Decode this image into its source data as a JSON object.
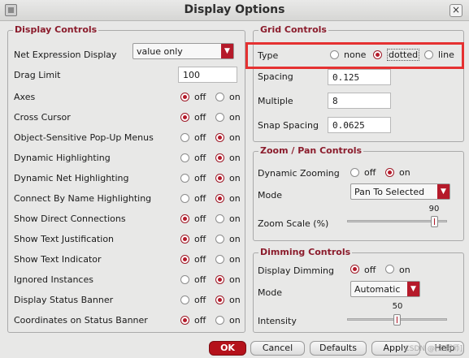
{
  "window": {
    "title": "Display Options"
  },
  "display_controls": {
    "title": "Display Controls",
    "net_expression": {
      "label": "Net Expression Display",
      "value": "value only"
    },
    "drag_limit": {
      "label": "Drag Limit",
      "value": "100"
    },
    "rows": [
      {
        "label": "Axes",
        "selected": "off"
      },
      {
        "label": "Cross Cursor",
        "selected": "off"
      },
      {
        "label": "Object-Sensitive Pop-Up Menus",
        "selected": "on"
      },
      {
        "label": "Dynamic Highlighting",
        "selected": "on"
      },
      {
        "label": "Dynamic Net Highlighting",
        "selected": "on"
      },
      {
        "label": "Connect By Name Highlighting",
        "selected": "on"
      },
      {
        "label": "Show Direct Connections",
        "selected": "off"
      },
      {
        "label": "Show Text Justification",
        "selected": "off"
      },
      {
        "label": "Show Text Indicator",
        "selected": "off"
      },
      {
        "label": "Ignored Instances",
        "selected": "on"
      },
      {
        "label": "Display Status Banner",
        "selected": "on"
      },
      {
        "label": "Coordinates on Status Banner",
        "selected": "off"
      }
    ],
    "opt_off": "off",
    "opt_on": "on"
  },
  "grid_controls": {
    "title": "Grid Controls",
    "type_label": "Type",
    "type_options": [
      "none",
      "dotted",
      "line"
    ],
    "type_selected": "dotted",
    "spacing": {
      "label": "Spacing",
      "value": "0.125"
    },
    "multiple": {
      "label": "Multiple",
      "value": "8"
    },
    "snap_spacing": {
      "label": "Snap Spacing",
      "value": "0.0625"
    }
  },
  "zoom_pan": {
    "title": "Zoom / Pan Controls",
    "dynamic_zooming": {
      "label": "Dynamic Zooming",
      "selected": "on"
    },
    "mode": {
      "label": "Mode",
      "value": "Pan To Selected"
    },
    "zoom_scale": {
      "label": "Zoom Scale (%)",
      "value": "90",
      "fraction": 0.9
    },
    "opt_off": "off",
    "opt_on": "on"
  },
  "dimming": {
    "title": "Dimming Controls",
    "display_dimming": {
      "label": "Display Dimming",
      "selected": "off"
    },
    "mode": {
      "label": "Mode",
      "value": "Automatic"
    },
    "intensity": {
      "label": "Intensity",
      "value": "50",
      "fraction": 0.5
    },
    "opt_off": "off",
    "opt_on": "on"
  },
  "buttons": {
    "ok": "OK",
    "cancel": "Cancel",
    "defaults": "Defaults",
    "apply": "Apply",
    "help": "Help"
  },
  "watermark": "CSDN @[工程师]"
}
